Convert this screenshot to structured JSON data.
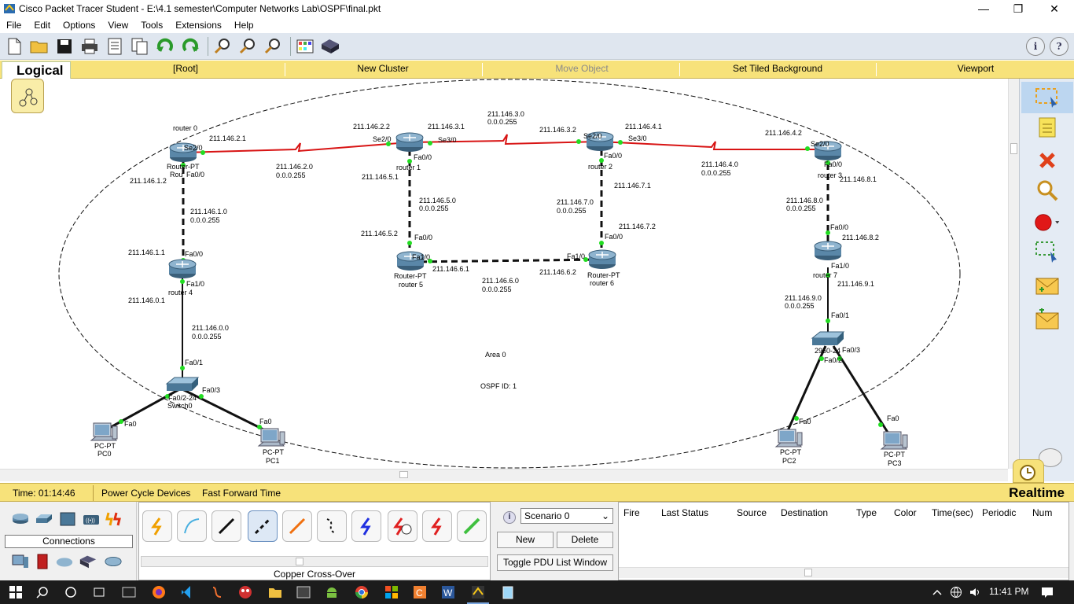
{
  "window": {
    "title": "Cisco Packet Tracer Student - E:\\4.1 semester\\Computer Networks Lab\\OSPF\\final.pkt",
    "minimize": "—",
    "maximize": "❐",
    "close": "✕"
  },
  "menu": [
    "File",
    "Edit",
    "Options",
    "View",
    "Tools",
    "Extensions",
    "Help"
  ],
  "toolbar": {
    "icons": [
      "new-icon",
      "open-icon",
      "save-icon",
      "print-icon",
      "activity-wizard-icon",
      "copy-icon",
      "undo-icon",
      "redo-icon",
      "zoom-in-icon",
      "zoom-reset-icon",
      "zoom-out-icon",
      "palette-icon",
      "custom-device-icon"
    ],
    "help_info": "i",
    "help_q": "?"
  },
  "logical_bar": {
    "tab": "Logical",
    "root": "[Root]",
    "new_cluster": "New Cluster",
    "move_object": "Move Object",
    "set_tiled_bg": "Set Tiled Background",
    "viewport": "Viewport"
  },
  "topology": {
    "area_label": "Area 0",
    "ospf_label": "OSPF ID: 1",
    "devices": [
      {
        "id": "r0",
        "top": "router 0",
        "type": "Router-PT",
        "short": "Rou"
      },
      {
        "id": "r1",
        "type": "Router-PT",
        "name": "router 1"
      },
      {
        "id": "r2",
        "type": "Router-PT",
        "name": "router 2"
      },
      {
        "id": "r3",
        "type": "Router-PT",
        "name": "router 3"
      },
      {
        "id": "r4",
        "type": "Router-PT",
        "name": "router 4"
      },
      {
        "id": "r5",
        "type": "Router-PT",
        "name": "router 5"
      },
      {
        "id": "r6",
        "type": "Router-PT",
        "name": "router 6"
      },
      {
        "id": "r7",
        "type": "Router-PT",
        "name": "router 7"
      },
      {
        "id": "sw0",
        "type": "2950-24",
        "name": "Switch0"
      },
      {
        "id": "sw1",
        "type": "2950-24",
        "name": "Switch1"
      },
      {
        "id": "pc0",
        "type": "PC-PT",
        "name": "PC0"
      },
      {
        "id": "pc1",
        "type": "PC-PT",
        "name": "PC1"
      },
      {
        "id": "pc2",
        "type": "PC-PT",
        "name": "PC2"
      },
      {
        "id": "pc3",
        "type": "PC-PT",
        "name": "PC3"
      }
    ],
    "labels": {
      "r0_se20": "Se2/0",
      "r0_ip": "211.146.2.1",
      "r0_fa00": "Fa0/0",
      "r0_ip2": "211.146.1.2",
      "net2": "211.146.2.0",
      "net2m": "0.0.0.255",
      "r1_se20": "Se2/0",
      "r1_se30": "Se3/0",
      "r1_ip_l": "211.146.2.2",
      "r1_ip_r": "211.146.3.1",
      "r1_fa00": "Fa0/0",
      "r1_ip_d": "211.146.5.1",
      "net3": "211.146.3.0",
      "net3m": "0.0.0.255",
      "r2_se20": "Se2/0",
      "r2_se30": "Se3/0",
      "r2_ip_l": "211.146.3.2",
      "r2_ip_r": "211.146.4.1",
      "r2_fa00": "Fa0/0",
      "r2_ip_d": "211.146.7.1",
      "net4": "211.146.4.0",
      "net4m": "0.0.0.255",
      "r3_se20": "Se2/0",
      "r3_fa00": "Fa0/0",
      "r3_ip_l": "211.146.4.2",
      "r3_ip_d": "211.146.8.1",
      "net1": "211.146.1.0",
      "net1m": "0.0.0.255",
      "net5": "211.146.5.0",
      "net5m": "0.0.0.255",
      "net7": "211.146.7.0",
      "net7m": "0.0.0.255",
      "net8": "211.146.8.0",
      "net8m": "0.0.0.255",
      "r4_ip_u": "211.146.1.1",
      "r4_fa00": "Fa0/0",
      "r4_fa10": "Fa1/0",
      "r4_ip_d": "211.146.0.1",
      "r5_ip_u": "211.146.5.2",
      "r5_fa00": "Fa0/0",
      "r5_fa10": "Fa1/0",
      "r5_ip_r": "211.146.6.1",
      "net6": "211.146.6.0",
      "net6m": "0.0.0.255",
      "r6_ip_l": "211.146.6.2",
      "r6_fa10": "Fa1/0",
      "r6_fa00": "Fa0/0",
      "r6_ip_u": "211.146.7.2",
      "r7_fa00": "Fa0/0",
      "r7_ip_u": "211.146.8.2",
      "r7_fa10": "Fa1/0",
      "r7_ip_d": "211.146.9.1",
      "net0": "211.146.0.0",
      "net0m": "0.0.0.255",
      "net9": "211.146.9.0",
      "net9m": "0.0.0.255",
      "sw0_fa01": "Fa0/1",
      "sw0_fa02": "Fa0/2-24",
      "sw0_fa03": "Fa0/3",
      "sw1_fa01": "Fa0/1",
      "sw1_fa02": "Fa0/2",
      "sw1_fa03": "Fa0/3",
      "pc_fa0": "Fa0"
    }
  },
  "right_tools": [
    "select-icon",
    "note-icon",
    "delete-icon",
    "inspect-icon",
    "draw-ellipse-icon",
    "resize-icon",
    "add-simple-pdu-icon",
    "add-complex-pdu-icon"
  ],
  "status": {
    "time": "Time: 01:14:46",
    "power_cycle": "Power Cycle Devices",
    "fast_forward": "Fast Forward Time",
    "mode": "Realtime"
  },
  "device_panel": {
    "connections_label": "Connections",
    "cable_name": "Copper Cross-Over"
  },
  "pdu": {
    "scenario": "Scenario 0",
    "new": "New",
    "delete": "Delete",
    "toggle": "Toggle PDU List Window",
    "headers": [
      "Fire",
      "Last Status",
      "Source",
      "Destination",
      "Type",
      "Color",
      "Time(sec)",
      "Periodic",
      "Num"
    ]
  },
  "taskbar": {
    "clock": "11:41 PM"
  }
}
